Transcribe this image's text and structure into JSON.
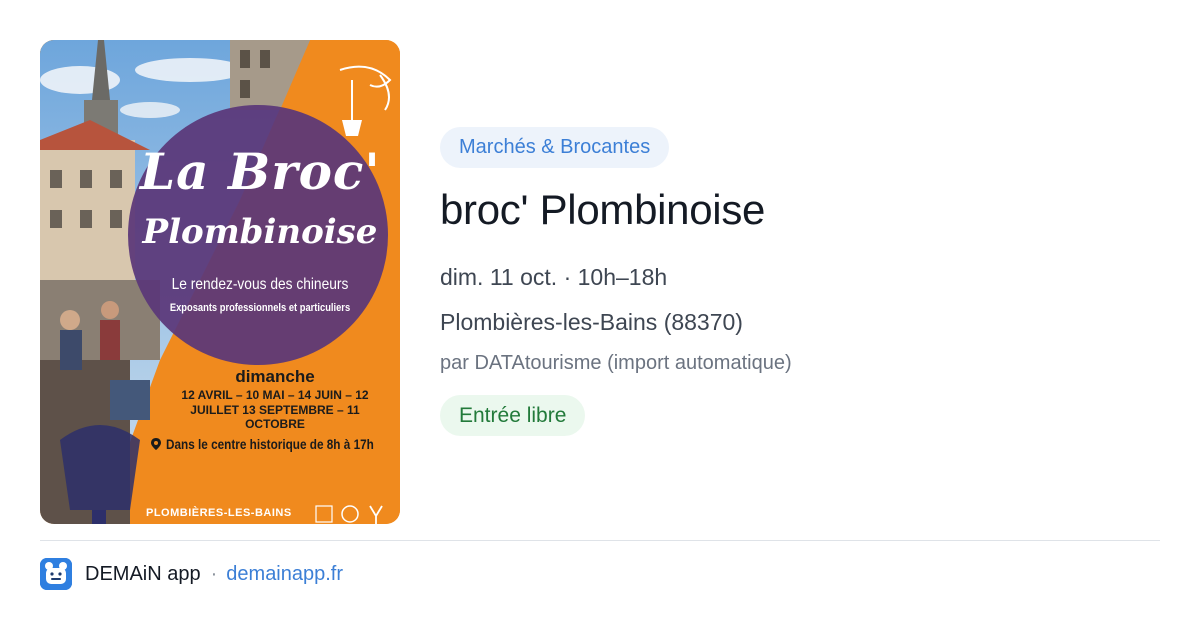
{
  "poster": {
    "title_line1": "La Broc'",
    "title_line2": "Plombinoise",
    "subtitle": "Le rendez-vous des chineurs",
    "subtitle2": "Exposants professionnels et particuliers",
    "day": "dimanche",
    "dates": "12 AVRIL – 10 MAI – 14 JUIN – 12 JUILLET 13 SEPTEMBRE – 11 OCTOBRE",
    "location": "Dans le centre historique de 8h à 17h",
    "town": "PLOMBIÈRES-LES-BAINS"
  },
  "event": {
    "category": "Marchés & Brocantes",
    "title": "broc' Plombinoise",
    "datetime": "dim. 11 oct. · 10h–18h",
    "location": "Plombières-les-Bains (88370)",
    "source": "par DATAtourisme (import automatique)",
    "price": "Entrée libre"
  },
  "footer": {
    "app_name": "DEMAiN app",
    "separator": "·",
    "link": "demainapp.fr"
  },
  "colors": {
    "accent": "#3c7fd6",
    "category_bg": "#edf3fb",
    "price_bg": "#ebf8ee",
    "price_text": "#227a3a",
    "poster_orange": "#f08a1e",
    "poster_purple": "#5a3778"
  },
  "icons": {
    "app": "demain-app-icon",
    "pin": "map-pin-icon"
  }
}
